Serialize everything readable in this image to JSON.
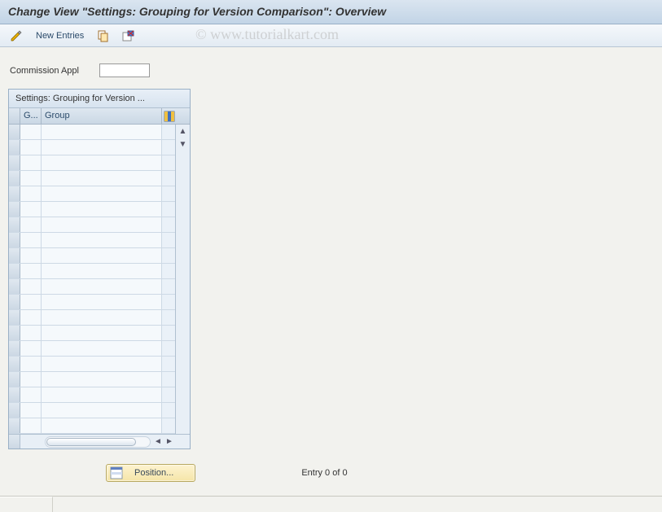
{
  "title": "Change View \"Settings: Grouping for Version Comparison\": Overview",
  "watermark": "© www.tutorialkart.com",
  "toolbar": {
    "new_entries_label": "New Entries"
  },
  "fields": {
    "commission_appl": {
      "label": "Commission Appl",
      "value": ""
    }
  },
  "table": {
    "caption": "Settings: Grouping for Version ...",
    "columns": {
      "col1": "G...",
      "col2": "Group"
    },
    "rows": []
  },
  "footer": {
    "position_label": "Position...",
    "entry_text": "Entry 0 of 0"
  },
  "icons": {
    "toggle": "toggle-icon",
    "copy": "copy-icon",
    "delete": "delete-icon",
    "config": "table-settings-icon",
    "position": "position-icon"
  }
}
